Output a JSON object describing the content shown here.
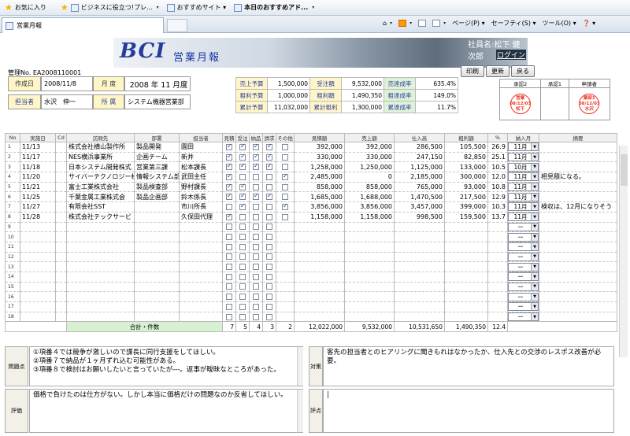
{
  "browser": {
    "favorites_label": "お気に入り",
    "fav_links": [
      "ビジネスに役立つ!プレ...",
      "おすすめサイト ▾",
      "本日のおすすめアド..."
    ],
    "tab_title": "営業月報",
    "menu": [
      "ページ(P) ▾",
      "セーフティ(S) ▾",
      "ツール(O) ▾",
      "❓ ▾"
    ]
  },
  "banner": {
    "logo": "BCI",
    "title": "営業月報",
    "user": "社員名:松下 健次郎",
    "login": "ログイン"
  },
  "header": {
    "mgmt_no": "管理No. EA2008110001",
    "created_label": "作成日",
    "created_value": "2008/11/8",
    "month_label": "月 度",
    "month_value": "2008 年 11 月度",
    "person_label": "担当者",
    "person_value": "水沢　伸一",
    "dept_label": "所 属",
    "dept_value": "システム機器営業部"
  },
  "buttons": {
    "print": "印刷",
    "update": "更新",
    "back": "戻る"
  },
  "summary": [
    [
      {
        "l": "売上予算",
        "v": "1,500,000"
      },
      {
        "l": "受注額",
        "v": "9,532,000"
      },
      {
        "l": "売達成率",
        "v": "635.4%"
      }
    ],
    [
      {
        "l": "粗利予算",
        "v": "1,000,000"
      },
      {
        "l": "粗利額",
        "v": "1,490,350"
      },
      {
        "l": "粗達成率",
        "v": "149.0%"
      }
    ],
    [
      {
        "l": "累計予算",
        "v": "11,032,000"
      },
      {
        "l": "累計粗利",
        "v": "1,300,000"
      },
      {
        "l": "累達成率",
        "v": "11.7%"
      }
    ]
  ],
  "approval": {
    "headers": [
      "承認2",
      "承認1",
      "申請者"
    ],
    "stamps": [
      {
        "top": "営業",
        "date": "08/12/03",
        "name": "松下"
      },
      {
        "top": "",
        "date": "",
        "name": ""
      },
      {
        "top": "業部1",
        "date": "08/12/03",
        "name": "水沢"
      }
    ]
  },
  "grid": {
    "headers": [
      "No",
      "実施日",
      "Cd",
      "訪問先",
      "部署",
      "担当者",
      "見積",
      "受注",
      "納品",
      "請求",
      "その他",
      "見積額",
      "売上額",
      "仕入高",
      "粗利額",
      "%",
      "納入月",
      "摘要"
    ],
    "rows": [
      {
        "no": "1",
        "date": "11/13",
        "cd": "",
        "client": "株式会社横山製作所",
        "dept": "製品開発",
        "person": "園田",
        "chk": [
          1,
          1,
          1,
          1,
          0
        ],
        "quote": "392,000",
        "sales": "392,000",
        "cost": "286,500",
        "profit": "105,500",
        "pct": "26.9",
        "month": "11月",
        "note": ""
      },
      {
        "no": "2",
        "date": "11/17",
        "cd": "",
        "client": "NES横浜事業所",
        "dept": "企画チーム",
        "person": "新井",
        "chk": [
          1,
          1,
          1,
          1,
          0
        ],
        "quote": "330,000",
        "sales": "330,000",
        "cost": "247,150",
        "profit": "82,850",
        "pct": "25.1",
        "month": "11月",
        "note": ""
      },
      {
        "no": "3",
        "date": "11/18",
        "cd": "",
        "client": "日本システム開発株式",
        "dept": "営業第三課",
        "person": "松本課長",
        "chk": [
          1,
          1,
          1,
          1,
          0
        ],
        "quote": "1,258,000",
        "sales": "1,250,000",
        "cost": "1,125,000",
        "profit": "133,000",
        "pct": "10.5",
        "month": "10月",
        "note": ""
      },
      {
        "no": "4",
        "date": "11/20",
        "cd": "",
        "client": "サイバーテクノロジー株",
        "dept": "情報システム部",
        "person": "武田主任",
        "chk": [
          1,
          0,
          0,
          0,
          1
        ],
        "quote": "2,485,000",
        "sales": "0",
        "cost": "2,185,000",
        "profit": "300,000",
        "pct": "12.0",
        "month": "11月",
        "note": "相見積になる。"
      },
      {
        "no": "5",
        "date": "11/21",
        "cd": "",
        "client": "富士工業株式会社",
        "dept": "製品検査部",
        "person": "野村課長",
        "chk": [
          1,
          1,
          0,
          0,
          0
        ],
        "quote": "858,000",
        "sales": "858,000",
        "cost": "765,000",
        "profit": "93,000",
        "pct": "10.8",
        "month": "11月",
        "note": ""
      },
      {
        "no": "6",
        "date": "11/25",
        "cd": "",
        "client": "千葉金属工業株式会",
        "dept": "製品企画部",
        "person": "鈴木係長",
        "chk": [
          1,
          1,
          1,
          1,
          0
        ],
        "quote": "1,685,000",
        "sales": "1,688,000",
        "cost": "1,470,500",
        "profit": "217,500",
        "pct": "12.9",
        "month": "11月",
        "note": ""
      },
      {
        "no": "7",
        "date": "11/27",
        "cd": "",
        "client": "有限会社SST",
        "dept": "",
        "person": "市川所長",
        "chk": [
          0,
          1,
          0,
          0,
          1
        ],
        "quote": "3,856,000",
        "sales": "3,856,000",
        "cost": "3,457,000",
        "profit": "399,000",
        "pct": "10.3",
        "month": "11月",
        "note": "検収は、12月になりそう"
      },
      {
        "no": "8",
        "date": "11/28",
        "cd": "",
        "client": "株式会社テックサービ",
        "dept": "",
        "person": "久保田代理",
        "chk": [
          1,
          0,
          0,
          0,
          0
        ],
        "quote": "1,158,000",
        "sales": "1,158,000",
        "cost": "998,500",
        "profit": "159,500",
        "pct": "13.7",
        "month": "11月",
        "note": ""
      },
      {
        "no": "9",
        "empty": true
      },
      {
        "no": "10",
        "empty": true
      },
      {
        "no": "11",
        "empty": true
      },
      {
        "no": "12",
        "empty": true
      },
      {
        "no": "13",
        "empty": true
      },
      {
        "no": "14",
        "empty": true
      },
      {
        "no": "15",
        "empty": true
      },
      {
        "no": "16",
        "empty": true
      },
      {
        "no": "17",
        "empty": true
      },
      {
        "no": "18",
        "empty": true
      }
    ],
    "empty_month": "ー",
    "totals": {
      "label": "合計・件数",
      "counts": [
        "7",
        "5",
        "4",
        "3",
        "2"
      ],
      "quote": "12,022,000",
      "sales": "9,532,000",
      "cost": "10,531,650",
      "profit": "1,490,350",
      "pct": "12.4"
    }
  },
  "notes": {
    "problem_label": "問題点",
    "problem_text": "①項番４では競争が激しいので課長に同行支援をしてほしい。\n②項番７で納品が１ヶ月ずれ込む可能性がある。\n③項番８で検討はお願いしたいと言っていたが---。返事が曖昧なところがあった。",
    "measure_label": "対策",
    "measure_text": "客先の担当者とのヒアリングに聞きもれはなかったか、仕入先との交渉のレスポス改善が必要。",
    "eval_label": "評価",
    "eval_text": "価格で負けたのは仕方がない。しかし本当に価格だけの問題なのか反省してほしい。",
    "review_label": "評点",
    "review_text": "|"
  }
}
